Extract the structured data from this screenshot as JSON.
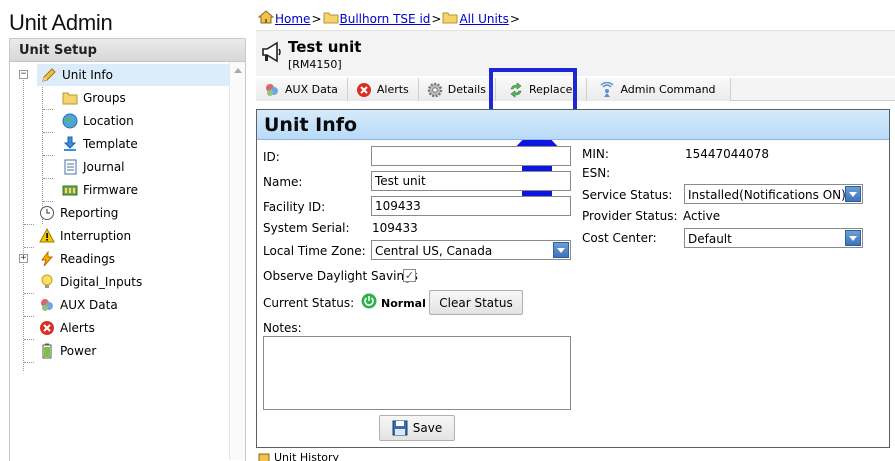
{
  "app": {
    "title": "Unit Admin"
  },
  "sidebar": {
    "header": "Unit Setup",
    "items": [
      {
        "label": "Unit Info",
        "icon": "pencil-icon"
      },
      {
        "label": "Groups",
        "icon": "folder-icon"
      },
      {
        "label": "Location",
        "icon": "globe-icon"
      },
      {
        "label": "Template",
        "icon": "download-icon"
      },
      {
        "label": "Journal",
        "icon": "journal-icon"
      },
      {
        "label": "Firmware",
        "icon": "firmware-icon"
      },
      {
        "label": "Reporting",
        "icon": "clock-icon"
      },
      {
        "label": "Interruption",
        "icon": "warning-icon"
      },
      {
        "label": "Readings",
        "icon": "lightning-icon"
      },
      {
        "label": "Digital_Inputs",
        "icon": "bulb-icon"
      },
      {
        "label": "AUX Data",
        "icon": "aux-data-icon"
      },
      {
        "label": "Alerts",
        "icon": "alert-icon"
      },
      {
        "label": "Power",
        "icon": "battery-icon"
      }
    ]
  },
  "breadcrumb": {
    "home": "Home",
    "sep": ">",
    "level1": "Bullhorn TSE id",
    "level2": "All Units"
  },
  "unit": {
    "name": "Test unit",
    "code": "[RM4150]"
  },
  "tabs": [
    {
      "label": "AUX Data",
      "icon": "aux-data-icon"
    },
    {
      "label": "Alerts",
      "icon": "alert-icon"
    },
    {
      "label": "Details",
      "icon": "gear-icon"
    },
    {
      "label": "Replace",
      "icon": "replace-icon"
    },
    {
      "label": "Admin Command",
      "icon": "admin-command-icon"
    }
  ],
  "panel": {
    "title": "Unit Info",
    "id_label": "ID:",
    "id_value": "",
    "name_label": "Name:",
    "name_value": "Test unit",
    "facility_label": "Facility ID:",
    "facility_value": "109433",
    "serial_label": "System Serial:",
    "serial_value": "109433",
    "tz_label": "Local Time Zone:",
    "tz_value": "Central US, Canada",
    "dst_label": "Observe Daylight Savings",
    "dst_checked": true,
    "status_label": "Current Status:",
    "status_value": "Normal",
    "clear_status": "Clear Status",
    "notes_label": "Notes:",
    "save": "Save",
    "min_label": "MIN:",
    "min_value": "15447044078",
    "esn_label": "ESN:",
    "esn_value": "",
    "service_label": "Service Status:",
    "service_value": "Installed(Notifications ON)",
    "provider_label": "Provider Status:",
    "provider_value": "Active",
    "cost_label": "Cost Center:",
    "cost_value": "Default"
  },
  "footer": {
    "history": "Unit History"
  },
  "colors": {
    "highlight": "#1d27d8",
    "arrow": "#0b17e0",
    "panel_title_bg": "#c8e2fa",
    "link": "#0000cc",
    "status_ok": "#2bb34a"
  }
}
